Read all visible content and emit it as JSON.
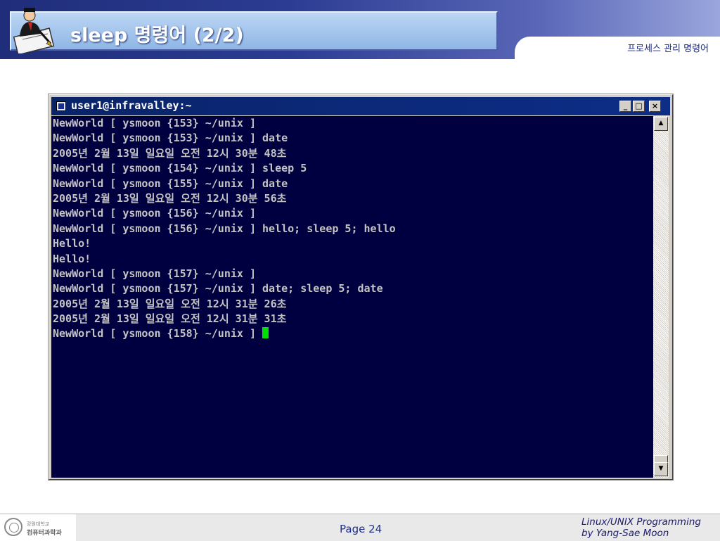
{
  "slide": {
    "title": "sleep 명령어 (2/2)",
    "subtitle": "프로세스 관리 명령어"
  },
  "window": {
    "title": "user1@infravalley:~",
    "controls": {
      "minimize": "_",
      "maximize": "□",
      "close": "×"
    }
  },
  "terminal": {
    "lines": [
      "NewWorld [ ysmoon {153} ~/unix ]",
      "NewWorld [ ysmoon {153} ~/unix ] date",
      "2005년 2월 13일 일요일 오전 12시 30분 48초",
      "NewWorld [ ysmoon {154} ~/unix ] sleep 5",
      "NewWorld [ ysmoon {155} ~/unix ] date",
      "2005년 2월 13일 일요일 오전 12시 30분 56초",
      "NewWorld [ ysmoon {156} ~/unix ]",
      "NewWorld [ ysmoon {156} ~/unix ] hello; sleep 5; hello",
      "Hello!",
      "Hello!",
      "NewWorld [ ysmoon {157} ~/unix ]",
      "NewWorld [ ysmoon {157} ~/unix ] date; sleep 5; date",
      "2005년 2월 13일 일요일 오전 12시 31분 26초",
      "2005년 2월 13일 일요일 오전 12시 31분 31초"
    ],
    "prompt": "NewWorld [ ysmoon {158} ~/unix ] ",
    "cursor_color": "#00e000"
  },
  "footer": {
    "university": "강원대학교",
    "department": "컴퓨터과학과",
    "page": "Page 24",
    "course_line1": "Linux/UNIX Programming",
    "course_line2": "by Yang-Sae Moon"
  }
}
